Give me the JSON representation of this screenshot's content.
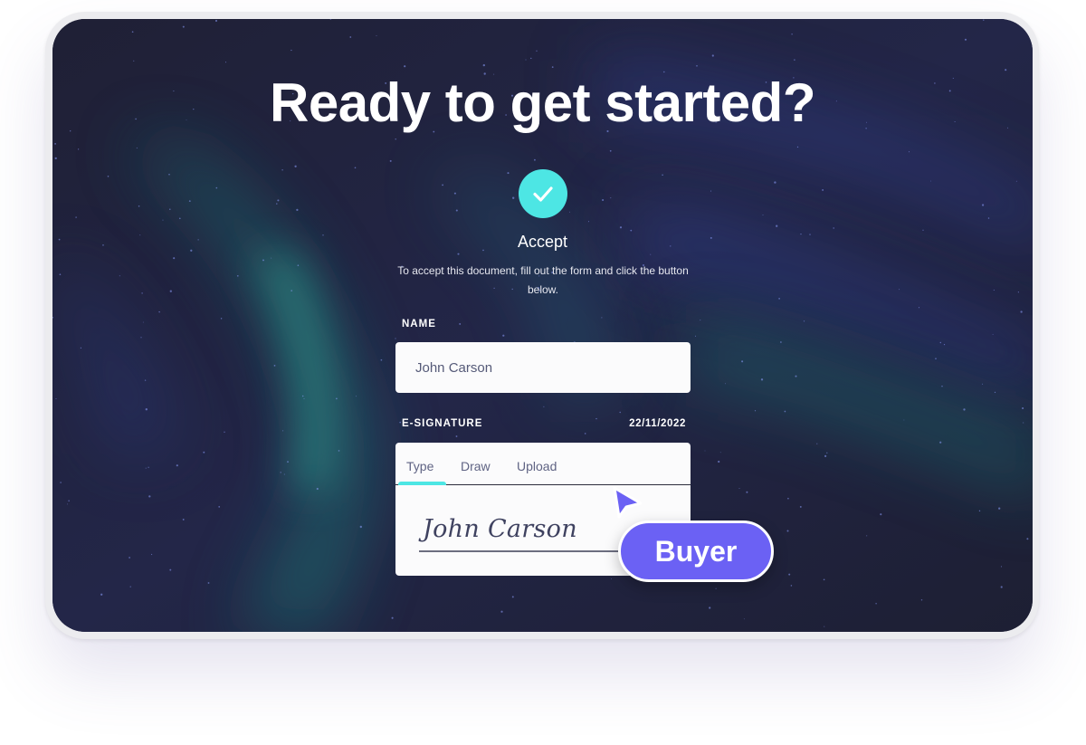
{
  "hero": {
    "title": "Ready to get started?"
  },
  "accept": {
    "icon": "check-icon",
    "heading": "Accept",
    "description": "To accept this document, fill out the form and click the button below."
  },
  "form": {
    "name_label": "NAME",
    "name_value": "John Carson",
    "signature_label": "E-SIGNATURE",
    "signature_date": "22/11/2022",
    "tabs": [
      {
        "label": "Type",
        "active": true
      },
      {
        "label": "Draw",
        "active": false
      },
      {
        "label": "Upload",
        "active": false
      }
    ],
    "typed_signature": "John Carson"
  },
  "cursor_badge": {
    "label": "Buyer",
    "color": "#6b61f4"
  },
  "colors": {
    "accent": "#4de6e4",
    "background": "#20213a",
    "badge": "#6b61f4"
  }
}
